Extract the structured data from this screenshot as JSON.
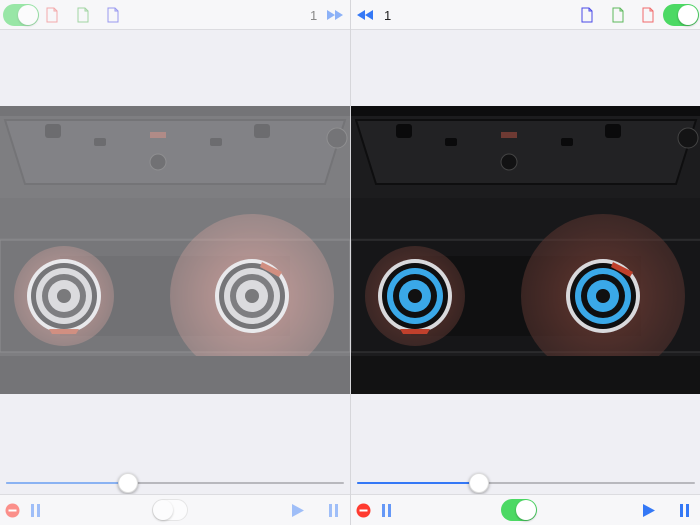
{
  "left": {
    "counter": "1",
    "toggle_on": true,
    "bottom_toggle_on": false,
    "slider_position": 0.36,
    "icons": {
      "toggle": "toggle-switch",
      "doc_red": "document-red-icon",
      "doc_green": "document-green-icon",
      "doc_blue": "document-blue-icon",
      "fast_forward": "fast-forward-icon",
      "stop": "stop-icon",
      "pause_left": "pause-icon",
      "play": "play-icon",
      "pause_right": "pause-icon"
    }
  },
  "right": {
    "counter": "1",
    "toggle_on": true,
    "bottom_toggle_on": true,
    "slider_position": 0.36,
    "icons": {
      "rewind": "rewind-icon",
      "doc_blue": "document-blue-icon",
      "doc_green": "document-green-icon",
      "doc_red": "document-red-icon",
      "toggle": "toggle-switch",
      "stop": "stop-icon",
      "pause_left": "pause-icon",
      "play": "play-icon",
      "pause_right": "pause-icon"
    }
  },
  "colors": {
    "accent_blue": "#3478f6",
    "reel_blue": "#3aa8e8",
    "stop_red": "#ff3b30",
    "toggle_green": "#4cd964",
    "doc_red": "#f06a6a",
    "doc_green": "#5cb85c",
    "doc_blue": "#4a4ae8"
  }
}
